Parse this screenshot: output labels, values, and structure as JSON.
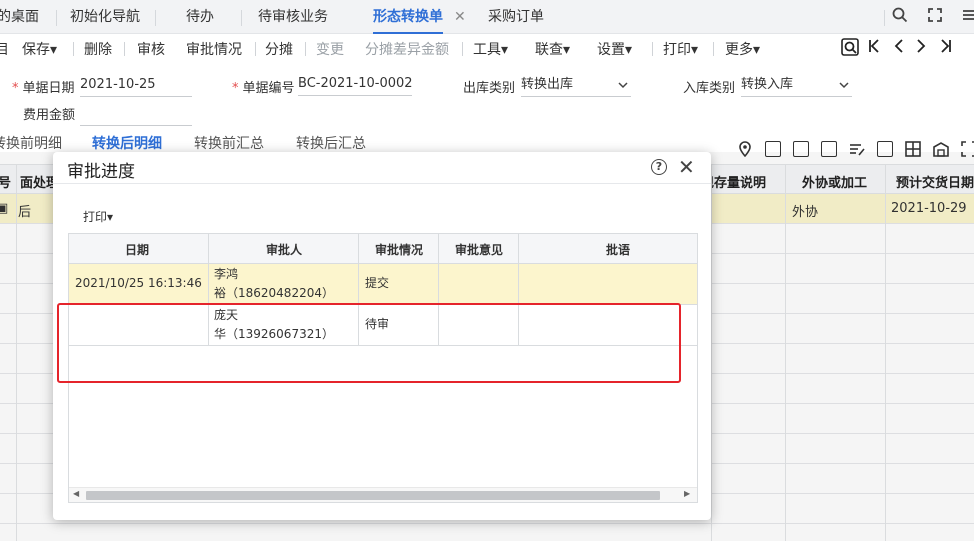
{
  "tabs": [
    {
      "label": "的桌面",
      "active": false
    },
    {
      "label": "初始化导航",
      "active": false
    },
    {
      "label": "待办",
      "active": false
    },
    {
      "label": "待审核业务",
      "active": false
    },
    {
      "label": "形态转换单",
      "active": true
    },
    {
      "label": "采购订单",
      "active": false
    }
  ],
  "tab_close_glyph": "✕",
  "window_icons": [
    "search-icon",
    "maximize-icon",
    "menu-icon"
  ],
  "toolbar": {
    "items": [
      {
        "label": "保存",
        "dropdown": true,
        "disabled": false
      },
      {
        "label": "删除",
        "dropdown": false,
        "disabled": false
      },
      {
        "label": "审核",
        "dropdown": false,
        "disabled": false
      },
      {
        "label": "审批情况",
        "dropdown": false,
        "disabled": false
      },
      {
        "label": "分摊",
        "dropdown": false,
        "disabled": false
      },
      {
        "label": "变更",
        "dropdown": false,
        "disabled": true
      },
      {
        "label": "分摊差异金额",
        "dropdown": false,
        "disabled": true
      },
      {
        "label": "工具",
        "dropdown": true,
        "disabled": false
      },
      {
        "label": "联查",
        "dropdown": true,
        "disabled": false
      },
      {
        "label": "设置",
        "dropdown": true,
        "disabled": false
      },
      {
        "label": "打印",
        "dropdown": true,
        "disabled": false
      },
      {
        "label": "更多",
        "dropdown": true,
        "disabled": false
      }
    ],
    "nav_icons": [
      "find-icon",
      "first-page-icon",
      "prev-page-icon",
      "next-page-icon",
      "last-page-icon"
    ]
  },
  "form": {
    "doc_date_label": "单据日期",
    "doc_date_value": "2021-10-25",
    "doc_no_label": "单据编号",
    "doc_no_value": "BC-2021-10-0002",
    "out_type_label": "出库类别",
    "out_type_value": "转换出库",
    "in_type_label": "入库类别",
    "in_type_value": "转换入库",
    "fee_label": "费用金额",
    "fee_value": ""
  },
  "subtabs": [
    {
      "label": "转换前明细",
      "active": false
    },
    {
      "label": "转换后明细",
      "active": true
    },
    {
      "label": "转换前汇总",
      "active": false
    },
    {
      "label": "转换后汇总",
      "active": false
    }
  ],
  "bg_table": {
    "headers": [
      "号",
      "面处理",
      "现存量说明",
      "外协或加工",
      "预计交货日期"
    ],
    "row1": [
      "",
      "后",
      "",
      "外协",
      "2021-10-29"
    ]
  },
  "dialog": {
    "title": "审批进度",
    "help_glyph": "?",
    "close_glyph": "✕",
    "print_label": "打印",
    "columns": [
      "日期",
      "审批人",
      "审批情况",
      "审批意见",
      "批语"
    ],
    "rows": [
      {
        "date": "2021/10/25 16:13:46",
        "approver_line1": "李鸿",
        "approver_line2": "裕（18620482204）",
        "status": "提交",
        "opinion": "",
        "remark": ""
      },
      {
        "date": "",
        "approver_line1": "庞天",
        "approver_line2": "华（13926067321）",
        "status": "待审",
        "opinion": "",
        "remark": ""
      }
    ]
  }
}
